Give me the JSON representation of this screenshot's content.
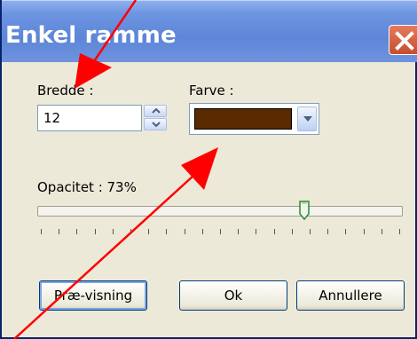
{
  "window": {
    "title": "Enkel ramme"
  },
  "fields": {
    "width_label": "Bredde :",
    "width_value": "12",
    "color_label": "Farve :",
    "color_value": "#5a2a00",
    "opacity_label": "Opacitet : 73%",
    "opacity_value": 73
  },
  "buttons": {
    "preview": "Præ-visning",
    "ok": "Ok",
    "cancel": "Annullere"
  },
  "colors": {
    "titlebar": "#6e95e2",
    "window_bg": "#ece9d8",
    "swatch": "#5a2a00",
    "annotation_arrow": "#ff0000",
    "close_button": "#d65b3c"
  }
}
